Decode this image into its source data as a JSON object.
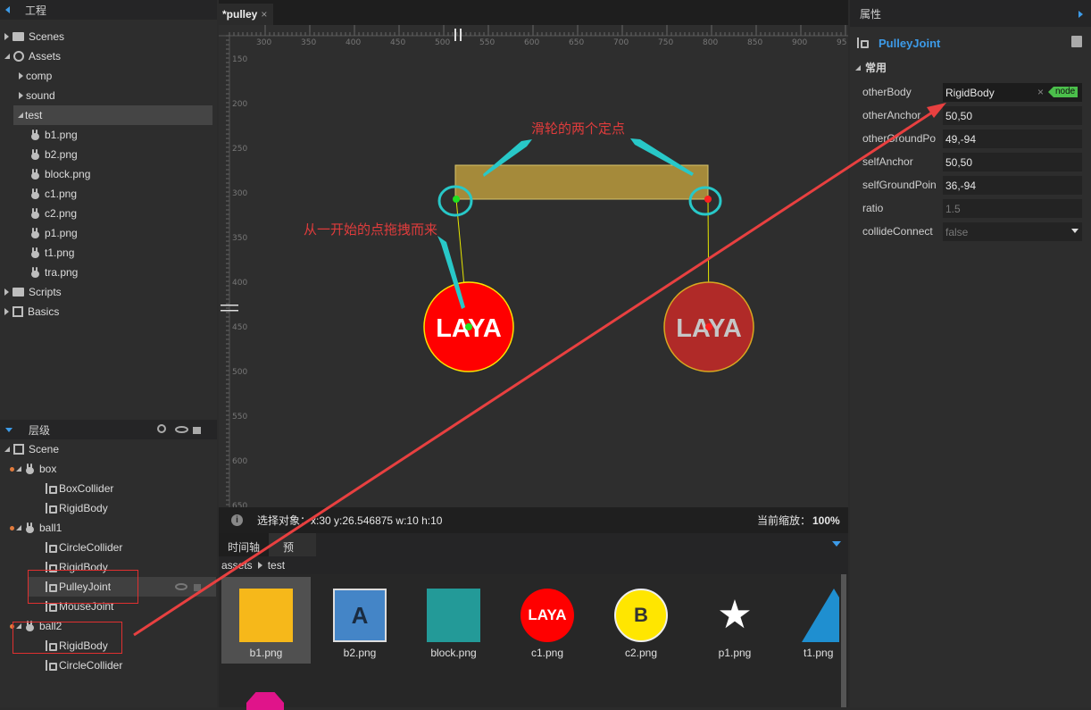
{
  "project_panel": {
    "title": "工程",
    "tree": [
      {
        "label": "Scenes"
      },
      {
        "label": "Assets"
      },
      {
        "label": "comp"
      },
      {
        "label": "sound"
      },
      {
        "label": "test"
      },
      {
        "label": "b1.png"
      },
      {
        "label": "b2.png"
      },
      {
        "label": "block.png"
      },
      {
        "label": "c1.png"
      },
      {
        "label": "c2.png"
      },
      {
        "label": "p1.png"
      },
      {
        "label": "t1.png"
      },
      {
        "label": "tra.png"
      },
      {
        "label": "Scripts"
      },
      {
        "label": "Basics"
      }
    ]
  },
  "hierarchy_panel": {
    "title": "层级",
    "tree": [
      {
        "label": "Scene"
      },
      {
        "label": "box"
      },
      {
        "label": "BoxCollider"
      },
      {
        "label": "RigidBody"
      },
      {
        "label": "ball1"
      },
      {
        "label": "CircleCollider"
      },
      {
        "label": "RigidBody"
      },
      {
        "label": "PulleyJoint"
      },
      {
        "label": "MouseJoint"
      },
      {
        "label": "ball2"
      },
      {
        "label": "RigidBody"
      },
      {
        "label": "CircleCollider"
      }
    ]
  },
  "editor": {
    "tab_label": "*pulley",
    "ruler_x": [
      "300",
      "350",
      "400",
      "450",
      "500",
      "550",
      "600",
      "650",
      "700",
      "750",
      "800",
      "850",
      "900",
      "95"
    ],
    "ruler_y": [
      "150",
      "200",
      "250",
      "300",
      "350",
      "400",
      "450",
      "500",
      "550",
      "600",
      "650"
    ],
    "ball_text": "LAYA",
    "annotation_top": "滑轮的两个定点",
    "annotation_left": "从一开始的点拖拽而来",
    "status_label": "选择对象：",
    "status_value": "x:30 y:26.546875  w:10 h:10",
    "zoom_label": "当前缩放：",
    "zoom_value": "100%"
  },
  "bottom_panel": {
    "tabs": [
      "时间轴",
      "预览"
    ],
    "crumb_root": "assets",
    "crumb_leaf": "test",
    "assets": [
      {
        "name": "b1.png"
      },
      {
        "name": "b2.png",
        "glyph": "A"
      },
      {
        "name": "block.png"
      },
      {
        "name": "c1.png",
        "glyph": "LAYA"
      },
      {
        "name": "c2.png",
        "glyph": "B"
      },
      {
        "name": "p1.png"
      },
      {
        "name": "t1.png"
      }
    ]
  },
  "properties_panel": {
    "title": "属性",
    "component": "PulleyJoint",
    "section": "常用",
    "props": [
      {
        "label": "otherBody",
        "value": "RigidBody"
      },
      {
        "label": "otherAnchor",
        "value": "50,50"
      },
      {
        "label": "otherGroundPo",
        "value": "49,-94"
      },
      {
        "label": "selfAnchor",
        "value": "50,50"
      },
      {
        "label": "selfGroundPoin",
        "value": "36,-94"
      },
      {
        "label": "ratio",
        "value": "1.5"
      },
      {
        "label": "collideConnect",
        "value": "false"
      }
    ],
    "node_badge": "node"
  },
  "colors": {
    "accent_blue": "#3d9be8",
    "annotation_red": "#e03c3c",
    "cyan": "#28c8c8",
    "box_fill": "#a58a3a",
    "ball_red": "#ff0000",
    "ball_dark": "#b02a28"
  }
}
